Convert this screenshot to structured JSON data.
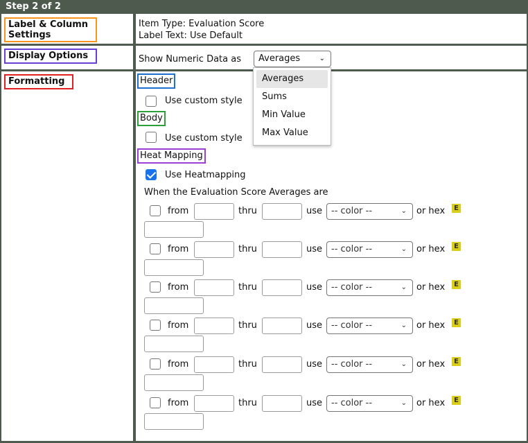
{
  "title": "Step 2 of 2",
  "sections": {
    "label_column": {
      "label": "Label & Column Settings",
      "item_type": "Item Type: Evaluation Score",
      "label_text": "Label Text: Use Default"
    },
    "display_options": {
      "label": "Display Options",
      "show_as": "Show Numeric Data as",
      "selected": "Averages",
      "options": [
        "Averages",
        "Sums",
        "Min Value",
        "Max Value"
      ]
    },
    "formatting": {
      "label": "Formatting",
      "header_label": "Header",
      "header_custom": "Use custom style",
      "body_label": "Body",
      "body_custom": "Use custom style",
      "heat_label": "Heat Mapping",
      "heat_use": "Use Heatmapping",
      "heat_desc": "When the Evaluation Score Averages are",
      "rule": {
        "from": "from",
        "thru": "thru",
        "use": "use",
        "color_placeholder": "-- color --",
        "or_hex": "or hex",
        "e_icon": "E"
      }
    }
  },
  "colors": {
    "frame": "#4d5a4d",
    "check_blue": "#1a73e8",
    "e_yellow": "#d9cf1a"
  }
}
